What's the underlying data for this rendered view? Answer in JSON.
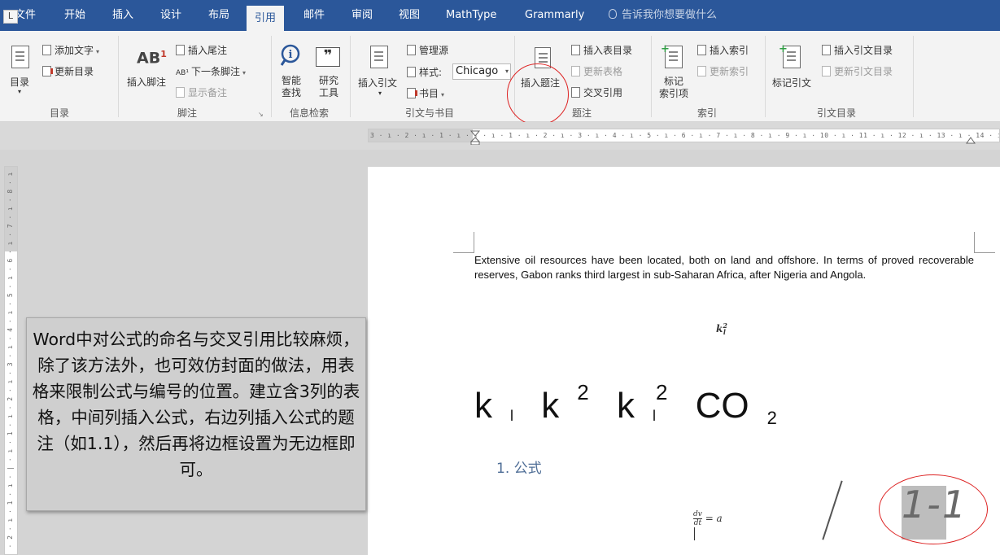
{
  "tabs": [
    {
      "id": "file",
      "label": "文件"
    },
    {
      "id": "home",
      "label": "开始"
    },
    {
      "id": "insert",
      "label": "插入"
    },
    {
      "id": "design",
      "label": "设计"
    },
    {
      "id": "layout",
      "label": "布局"
    },
    {
      "id": "references",
      "label": "引用",
      "active": true
    },
    {
      "id": "mailings",
      "label": "邮件"
    },
    {
      "id": "review",
      "label": "审阅"
    },
    {
      "id": "view",
      "label": "视图"
    },
    {
      "id": "mathtype",
      "label": "MathType"
    },
    {
      "id": "grammarly",
      "label": "Grammarly"
    }
  ],
  "tell_me": "告诉我你想要做什么",
  "ribbon": {
    "toc": {
      "big": "目录",
      "add_text": "添加文字",
      "update_toc": "更新目录",
      "label": "目录"
    },
    "footnotes": {
      "insert_footnote": "插入脚注",
      "insert_endnote": "插入尾注",
      "next_footnote": "下一条脚注",
      "show_notes": "显示备注",
      "label": "脚注"
    },
    "research": {
      "smart_lookup": "智能\n查找",
      "researcher": "研究\n工具",
      "label": "信息检索"
    },
    "citations": {
      "insert_citation": "插入引文",
      "manage_sources": "管理源",
      "style_label": "样式:",
      "style_value": "Chicago",
      "bibliography": "书目",
      "label": "引文与书目"
    },
    "captions": {
      "insert_caption": "插入题注",
      "insert_tof": "插入表目录",
      "update_table": "更新表格",
      "cross_reference": "交叉引用",
      "label": "题注"
    },
    "index": {
      "mark_entry": "标记\n索引项",
      "insert_index": "插入索引",
      "update_index": "更新索引",
      "label": "索引"
    },
    "toa": {
      "mark_citation": "标记引文",
      "insert_toa": "插入引文目录",
      "update_toa": "更新引文目录",
      "label": "引文目录"
    }
  },
  "ruler": {
    "horizontal": "3 · ı · 2 · ı · 1 · ı · | · ı · 1 · ı · 2 · ı · 3 · ı · 4 · ı · 5 · ı · 6 · ı · 7 · ı · 8 · ı · 9 · ı · 10 · ı · 11 · ı · 12 · ı · 13 · ı · 14 · ı · 15 ·",
    "vertical": "· 2 · ı · 1 · ı · | · ı · 1 · ı · 2 · ı · 3 · ı · 4 · ı · 5 · ı · 6 · ı · 7 · ı · 8 · ı"
  },
  "document": {
    "paragraph": "Extensive oil resources have been located, both on land and offshore. In terms of proved recoverable reserves, Gabon ranks third largest in sub-Saharan Africa, after Nigeria and Angola.",
    "formula_small": {
      "base": "k",
      "sup": "2",
      "sub": "l"
    },
    "big_formulas": [
      {
        "base": "k",
        "sub": "l"
      },
      {
        "base": "k",
        "sup": "2"
      },
      {
        "base": "k",
        "sub": "l",
        "sup": "2"
      },
      {
        "base": "CO",
        "sub": "2"
      }
    ],
    "heading": "1. 公式",
    "dvdt": {
      "num": "dv",
      "den": "dt",
      "rhs": "= a"
    },
    "caption_number": "1-1"
  },
  "note_text": "Word中对公式的命名与交叉引用比较麻烦，除了该方法外，也可效仿封面的做法，用表格来限制公式与编号的位置。建立含3列的表格，中间列插入公式，右边列插入公式的题注（如1.1），然后再将边框设置为无边框即可。",
  "colors": {
    "tab_bar": "#2b579a",
    "ribbon": "#f3f3f3",
    "highlight_circle": "#dd2222"
  }
}
